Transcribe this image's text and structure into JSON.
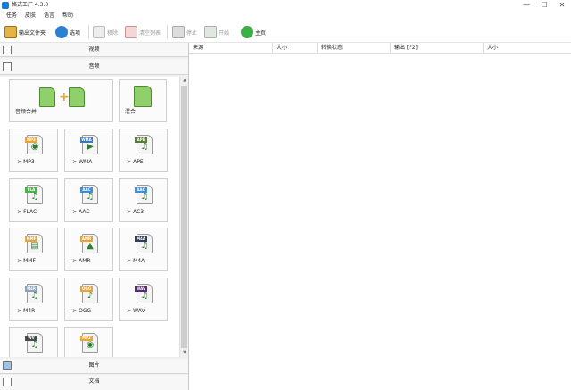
{
  "window": {
    "title": "格式工厂 4.3.0",
    "minimize": "—",
    "maximize": "☐",
    "close": "✕"
  },
  "menu": [
    {
      "label": "任务"
    },
    {
      "label": "皮肤"
    },
    {
      "label": "语言"
    },
    {
      "label": "帮助"
    }
  ],
  "toolbar": {
    "output_folder": "输出文件夹",
    "options": "选项",
    "remove": "移除",
    "clear_list": "清空列表",
    "stop": "停止",
    "start": "开始",
    "home": "主页"
  },
  "categories": {
    "video": "视频",
    "audio": "音频",
    "picture": "图片",
    "document": "文档"
  },
  "audio_tiles": [
    {
      "label": "音频合并",
      "tag": "",
      "icon": "audio-merge-icon"
    },
    {
      "label": "混合",
      "tag": "",
      "icon": "audio-mix-icon"
    },
    {
      "label": "-> MP3",
      "tag": "MP3",
      "icon": "mp3-file-icon",
      "color": "#e8a33b",
      "glyph": "◉"
    },
    {
      "label": "-> WMA",
      "tag": "WMA",
      "icon": "wma-file-icon",
      "color": "#3c78c3",
      "glyph": "▶"
    },
    {
      "label": "-> APE",
      "tag": "APE",
      "icon": "ape-file-icon",
      "color": "#5a7d3c",
      "glyph": "♫"
    },
    {
      "label": "-> FLAC",
      "tag": "FLA",
      "icon": "flac-file-icon",
      "color": "#4caf50",
      "glyph": "♫"
    },
    {
      "label": "-> AAC",
      "tag": "AAC",
      "icon": "aac-file-icon",
      "color": "#3f8fd8",
      "glyph": "♫"
    },
    {
      "label": "-> AC3",
      "tag": "AAC",
      "icon": "ac3-file-icon",
      "color": "#3f8fd8",
      "glyph": "♫"
    },
    {
      "label": "-> MMF",
      "tag": "MMF",
      "icon": "mmf-file-icon",
      "color": "#e8a33b",
      "glyph": "▤"
    },
    {
      "label": "-> AMR",
      "tag": "AMR",
      "icon": "amr-file-icon",
      "color": "#e8a33b",
      "glyph": "▲"
    },
    {
      "label": "-> M4A",
      "tag": "M4A",
      "icon": "m4a-file-icon",
      "color": "#2d3e5c",
      "glyph": "♫"
    },
    {
      "label": "-> M4R",
      "tag": "M4R",
      "icon": "m4r-file-icon",
      "color": "#8aa2b8",
      "glyph": "♫"
    },
    {
      "label": "-> OGG",
      "tag": "OGG",
      "icon": "ogg-file-icon",
      "color": "#e8a33b",
      "glyph": "♪"
    },
    {
      "label": "-> WAV",
      "tag": "WAV",
      "icon": "wav-file-icon",
      "color": "#5b2a75",
      "glyph": "♫"
    },
    {
      "label": "",
      "tag": "WV",
      "icon": "wv-file-icon",
      "color": "#4a4a4a",
      "glyph": "♫"
    },
    {
      "label": "",
      "tag": "MP2",
      "icon": "mp2-file-icon",
      "color": "#e8a33b",
      "glyph": "◉"
    }
  ],
  "task_columns": [
    "来源",
    "大小",
    "转换状态",
    "输出 [F2]",
    "大小"
  ]
}
